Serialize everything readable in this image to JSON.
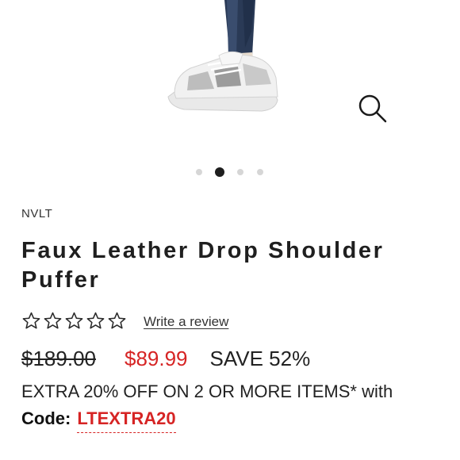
{
  "product": {
    "brand": "NVLT",
    "title": "Faux Leather Drop Shoulder Puffer",
    "rating_stars": 0,
    "rating_max": 5,
    "review_link": "Write a review"
  },
  "pricing": {
    "original": "$189.00",
    "sale": "$89.99",
    "savings": "SAVE 52%",
    "sale_color": "#d62424"
  },
  "promo": {
    "text": "EXTRA 20% OFF ON 2 OR MORE ITEMS* with",
    "code_label": "Code:",
    "code_value": "LTEXTRA20"
  },
  "gallery": {
    "image_count": 4,
    "active_index": 1,
    "zoom_icon": "magnifier-icon"
  }
}
